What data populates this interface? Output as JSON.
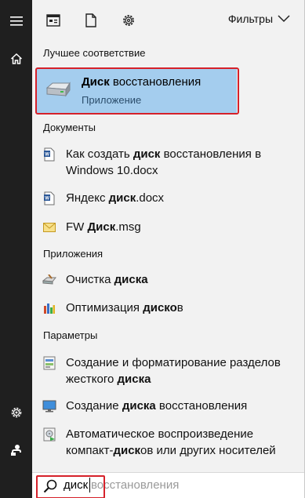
{
  "toolbar": {
    "filters_label": "Фильтры"
  },
  "best_match": {
    "header": "Лучшее соответствие",
    "title_bold": "Диск",
    "title_rest": " восстановления",
    "subtitle": "Приложение"
  },
  "documents": {
    "header": "Документы",
    "items": [
      {
        "pre": "Как создать ",
        "bold": "диск",
        "post": " восстановления в",
        "line2": "Windows 10.docx",
        "icon": "word-doc-icon"
      },
      {
        "pre": "Яндекс ",
        "bold": "диск",
        "post": ".docx",
        "icon": "word-doc-icon"
      },
      {
        "pre": "FW ",
        "bold": "Диск",
        "post": ".msg",
        "icon": "mail-envelope-icon"
      }
    ]
  },
  "apps": {
    "header": "Приложения",
    "items": [
      {
        "pre": "Очистка ",
        "bold": "диска",
        "post": "",
        "icon": "disk-cleanup-icon"
      },
      {
        "pre": "Оптимизация ",
        "bold": "диско",
        "post": "в",
        "icon": "defrag-icon"
      }
    ]
  },
  "settings": {
    "header": "Параметры",
    "items": [
      {
        "pre": "Создание и форматирование разделов",
        "line2_pre": "жесткого ",
        "line2_bold": "диска",
        "line2_post": "",
        "icon": "disk-partition-icon"
      },
      {
        "pre": "Создание ",
        "bold": "диска",
        "post": " восстановления",
        "icon": "monitor-recovery-icon"
      },
      {
        "pre": "Автоматическое воспроизведение",
        "line2_pre": "компакт-",
        "line2_bold": "диск",
        "line2_post": "ов или других носителей",
        "icon": "autoplay-icon"
      }
    ]
  },
  "search": {
    "typed": "диск",
    "suggestion": "восстановления"
  },
  "colors": {
    "highlight": "#a4cdee",
    "annotation_red": "#d6212a",
    "rail": "#1f1f1f"
  }
}
